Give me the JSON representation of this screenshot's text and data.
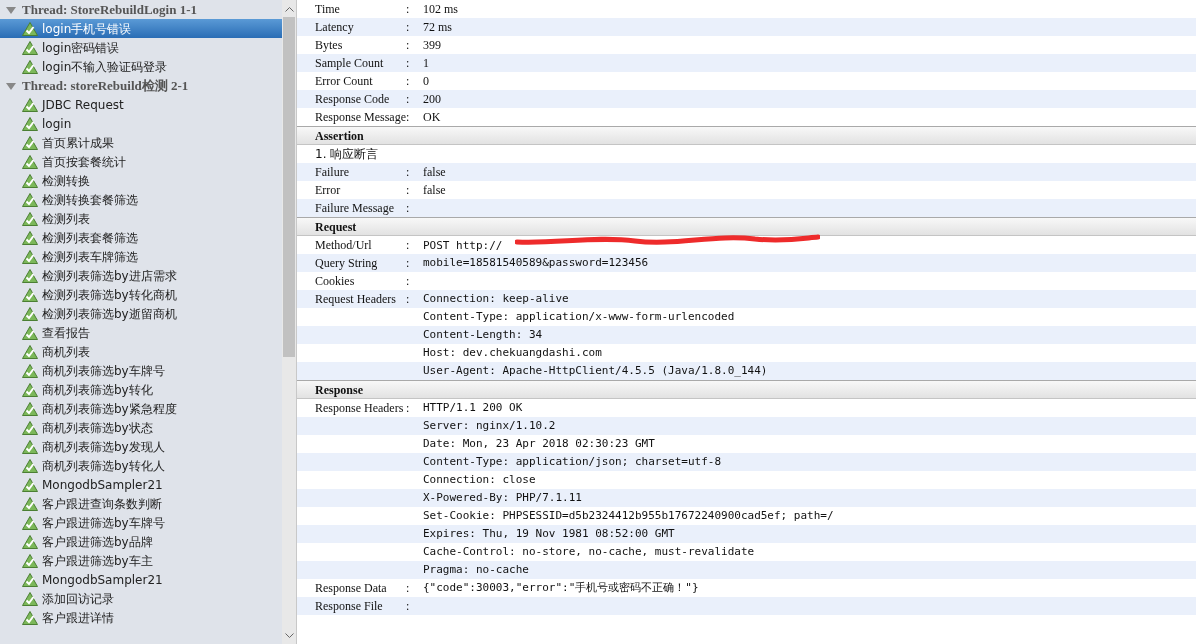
{
  "tree": [
    {
      "label": "Thread: StoreRebuildLogin 1-1",
      "expanded": true,
      "children": [
        {
          "label": "login手机号错误",
          "selected": true
        },
        {
          "label": "login密码错误",
          "selected": false
        },
        {
          "label": "login不输入验证码登录",
          "selected": false
        }
      ]
    },
    {
      "label": "Thread: storeRebuild检测 2-1",
      "expanded": true,
      "children": [
        {
          "label": "JDBC Request",
          "selected": false
        },
        {
          "label": "login",
          "selected": false
        },
        {
          "label": "首页累计成果",
          "selected": false
        },
        {
          "label": "首页按套餐统计",
          "selected": false
        },
        {
          "label": "检测转换",
          "selected": false
        },
        {
          "label": "检测转换套餐筛选",
          "selected": false
        },
        {
          "label": "检测列表",
          "selected": false
        },
        {
          "label": "检测列表套餐筛选",
          "selected": false
        },
        {
          "label": "检测列表车牌筛选",
          "selected": false
        },
        {
          "label": "检测列表筛选by进店需求",
          "selected": false
        },
        {
          "label": "检测列表筛选by转化商机",
          "selected": false
        },
        {
          "label": "检测列表筛选by逝留商机",
          "selected": false
        },
        {
          "label": "查看报告",
          "selected": false
        },
        {
          "label": "商机列表",
          "selected": false
        },
        {
          "label": "商机列表筛选by车牌号",
          "selected": false
        },
        {
          "label": "商机列表筛选by转化",
          "selected": false
        },
        {
          "label": "商机列表筛选by紧急程度",
          "selected": false
        },
        {
          "label": "商机列表筛选by状态",
          "selected": false
        },
        {
          "label": "商机列表筛选by发现人",
          "selected": false
        },
        {
          "label": "商机列表筛选by转化人",
          "selected": false
        },
        {
          "label": "MongodbSampler21",
          "selected": false
        },
        {
          "label": "客户跟进查询条数判断",
          "selected": false
        },
        {
          "label": "客户跟进筛选by车牌号",
          "selected": false
        },
        {
          "label": "客户跟进筛选by品牌",
          "selected": false
        },
        {
          "label": "客户跟进筛选by车主",
          "selected": false
        },
        {
          "label": "MongodbSampler21",
          "selected": false
        },
        {
          "label": "添加回访记录",
          "selected": false
        },
        {
          "label": "客户跟进详情",
          "selected": false
        }
      ]
    }
  ],
  "details": [
    {
      "rows": [
        {
          "kind": "field",
          "label": "Time",
          "colon": ":",
          "values": [
            "102 ms"
          ]
        },
        {
          "kind": "field",
          "label": "Latency",
          "colon": ":",
          "values": [
            "72 ms"
          ]
        },
        {
          "kind": "field",
          "label": "Bytes",
          "colon": ":",
          "values": [
            "399"
          ]
        },
        {
          "kind": "field",
          "label": "Sample Count",
          "colon": ":",
          "values": [
            "1"
          ]
        },
        {
          "kind": "field",
          "label": "Error Count",
          "colon": ":",
          "values": [
            "0"
          ]
        },
        {
          "kind": "field",
          "label": "Response Code",
          "colon": ":",
          "values": [
            "200"
          ]
        },
        {
          "kind": "field",
          "label": "Response Message",
          "colon": ":",
          "values": [
            "OK"
          ]
        }
      ]
    },
    {
      "title": "Assertion",
      "rows": [
        {
          "kind": "note",
          "label": "1. 响应断言"
        },
        {
          "kind": "field",
          "label": "Failure",
          "colon": ":",
          "values": [
            "false"
          ]
        },
        {
          "kind": "field",
          "label": "Error",
          "colon": ":",
          "values": [
            "false"
          ]
        },
        {
          "kind": "field",
          "label": "Failure Message",
          "colon": ":"
        }
      ]
    },
    {
      "title": "Request",
      "rows": [
        {
          "kind": "code",
          "label": "Method/Url",
          "colon": ":",
          "values": [
            "POST http://"
          ],
          "redacted": true
        },
        {
          "kind": "code",
          "label": "Query String",
          "colon": ":",
          "values": [
            "mobile=18581540589&password=123456"
          ]
        },
        {
          "kind": "code",
          "label": "Cookies",
          "colon": ":"
        },
        {
          "kind": "code",
          "label": "Request Headers",
          "colon": ":",
          "values": [
            "Connection: keep-alive",
            "Content-Type: application/x-www-form-urlencoded",
            "Content-Length: 34",
            "Host: dev.chekuangdashi.com",
            "User-Agent: Apache-HttpClient/4.5.5 (Java/1.8.0_144)"
          ]
        }
      ]
    },
    {
      "title": "Response",
      "rows": [
        {
          "kind": "code",
          "label": "Response Headers",
          "colon": ":",
          "values": [
            "HTTP/1.1 200 OK",
            "Server: nginx/1.10.2",
            "Date: Mon, 23 Apr 2018 02:30:23 GMT",
            "Content-Type: application/json; charset=utf-8",
            "Connection: close",
            "X-Powered-By: PHP/7.1.11",
            "Set-Cookie: PHPSESSID=d5b2324412b955b17672240900cad5ef; path=/",
            "Expires: Thu, 19 Nov 1981 08:52:00 GMT",
            "Cache-Control: no-store, no-cache, must-revalidate",
            "Pragma: no-cache"
          ]
        },
        {
          "kind": "code",
          "label": "Response Data",
          "colon": ":",
          "values": [
            "{\"code\":30003,\"error\":\"手机号或密码不正确！\"}"
          ]
        },
        {
          "kind": "code",
          "label": "Response File",
          "colon": ":"
        }
      ]
    }
  ]
}
